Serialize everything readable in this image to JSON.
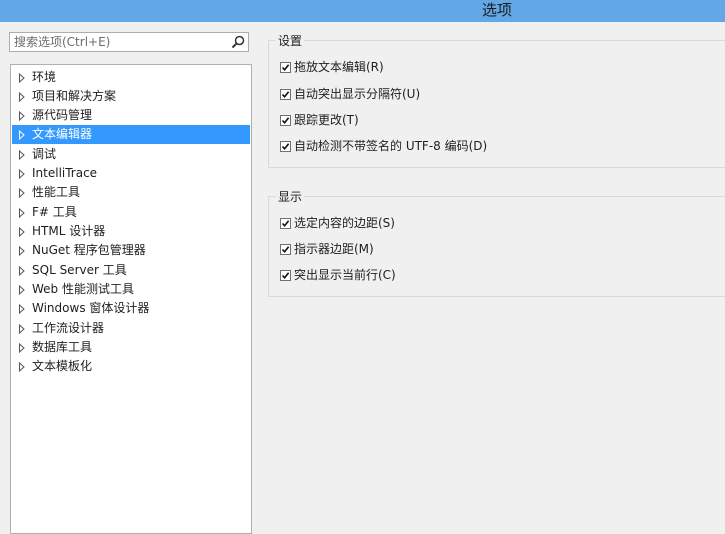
{
  "window": {
    "title": "选项"
  },
  "search": {
    "placeholder": "搜索选项(Ctrl+E)"
  },
  "tree": {
    "items": [
      {
        "label": "环境",
        "selected": false
      },
      {
        "label": "项目和解决方案",
        "selected": false
      },
      {
        "label": "源代码管理",
        "selected": false
      },
      {
        "label": "文本编辑器",
        "selected": true
      },
      {
        "label": "调试",
        "selected": false
      },
      {
        "label": "IntelliTrace",
        "selected": false
      },
      {
        "label": "性能工具",
        "selected": false
      },
      {
        "label": "F# 工具",
        "selected": false
      },
      {
        "label": "HTML 设计器",
        "selected": false
      },
      {
        "label": "NuGet 程序包管理器",
        "selected": false
      },
      {
        "label": "SQL Server 工具",
        "selected": false
      },
      {
        "label": "Web 性能测试工具",
        "selected": false
      },
      {
        "label": "Windows 窗体设计器",
        "selected": false
      },
      {
        "label": "工作流设计器",
        "selected": false
      },
      {
        "label": "数据库工具",
        "selected": false
      },
      {
        "label": "文本模板化",
        "selected": false
      }
    ]
  },
  "groups": {
    "settings": {
      "title": "设置",
      "options": [
        {
          "label": "拖放文本编辑(R)",
          "checked": true
        },
        {
          "label": "自动突出显示分隔符(U)",
          "checked": true
        },
        {
          "label": "跟踪更改(T)",
          "checked": true
        },
        {
          "label": "自动检测不带签名的 UTF-8 编码(D)",
          "checked": true
        }
      ]
    },
    "display": {
      "title": "显示",
      "options": [
        {
          "label": "选定内容的边距(S)",
          "checked": true
        },
        {
          "label": "指示器边距(M)",
          "checked": true
        },
        {
          "label": "突出显示当前行(C)",
          "checked": true
        }
      ]
    }
  },
  "colors": {
    "titlebar": "#62a8e6",
    "selection": "#3399ff"
  }
}
